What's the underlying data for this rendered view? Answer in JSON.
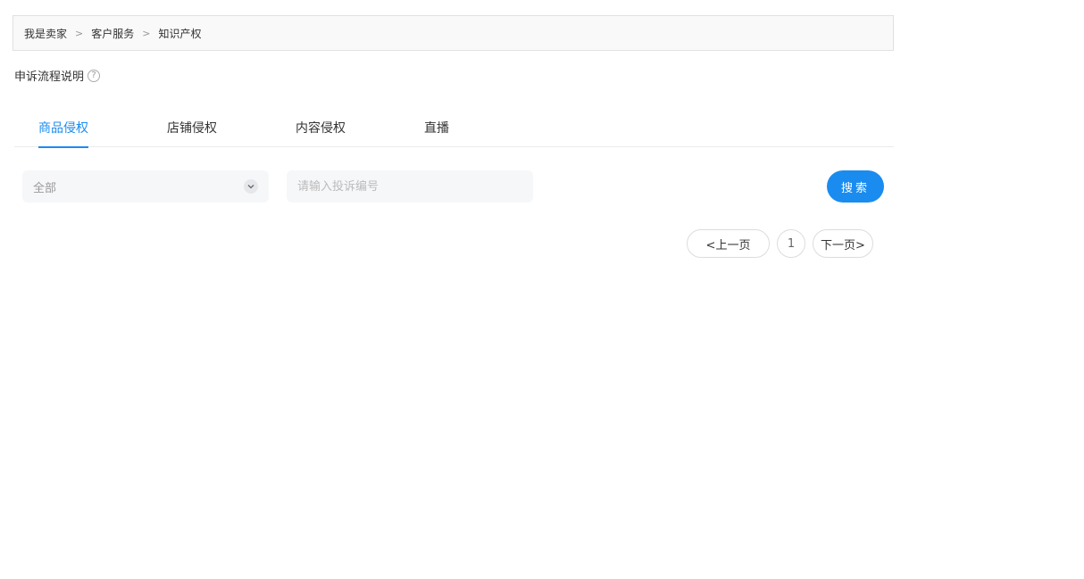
{
  "breadcrumb": {
    "items": [
      "我是卖家",
      "客户服务",
      "知识产权"
    ],
    "separator": ">"
  },
  "help": {
    "label": "申诉流程说明",
    "icon": "question-circle-icon",
    "icon_glyph": "?"
  },
  "tabs": [
    {
      "label": "商品侵权",
      "active": true
    },
    {
      "label": "店铺侵权",
      "active": false
    },
    {
      "label": "内容侵权",
      "active": false
    },
    {
      "label": "直播",
      "active": false
    }
  ],
  "filter": {
    "select_value": "全部",
    "select_icon": "chevron-down-icon",
    "search_placeholder": "请输入投诉编号",
    "search_value": "",
    "search_button": "搜索"
  },
  "pagination": {
    "prev_label": "<上一页",
    "current_page": "1",
    "next_label": "下一页>"
  },
  "colors": {
    "accent": "#1a8cef",
    "breadcrumb_bg": "#f9f9f9",
    "input_bg": "#f6f7f9"
  }
}
